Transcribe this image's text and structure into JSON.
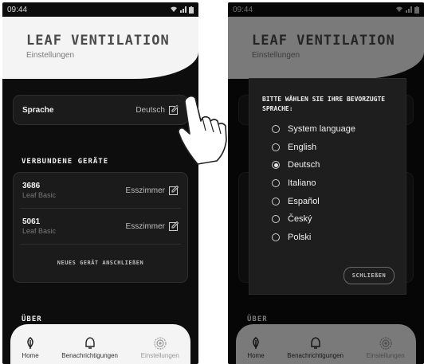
{
  "left_screen": {
    "status": {
      "time": "09:44"
    },
    "header": {
      "title": "LEAF VENTILATION",
      "subtitle": "Einstellungen"
    },
    "language_row": {
      "label": "Sprache",
      "value": "Deutsch"
    },
    "devices": {
      "title": "VERBUNDENE GERÄTE",
      "items": [
        {
          "name": "3686",
          "model": "Leaf Basic",
          "room": "Esszimmer"
        },
        {
          "name": "5061",
          "model": "Leaf Basic",
          "room": "Esszimmer"
        }
      ],
      "add_label": "NEUES GERÄT ANSCHLIEßEN"
    },
    "about": {
      "title": "ÜBER"
    }
  },
  "right_screen": {
    "status": {
      "time": "09:44"
    },
    "header": {
      "title": "LEAF VENTILATION",
      "subtitle": "Einstellungen"
    },
    "dialog": {
      "title": "BITTE WÄHLEN SIE IHRE BEVORZUGTE SPRACHE:",
      "options": [
        "System language",
        "English",
        "Deutsch",
        "Italiano",
        "Español",
        "Český",
        "Polski"
      ],
      "selected": "Deutsch",
      "close_label": "SCHLIEßEN"
    },
    "about": {
      "title": "ÜBER"
    }
  },
  "nav": {
    "items": [
      "Home",
      "Benachrichtigungen",
      "Einstellungen"
    ]
  },
  "icons": {
    "edit": "edit-icon",
    "home": "leaf-icon",
    "notifications": "bell-icon",
    "settings": "gear-icon",
    "pointer": "hand-pointer-icon"
  },
  "colors": {
    "background": "#0d0d0d",
    "card": "#1b1b1b",
    "header": "#f4f4f4"
  }
}
